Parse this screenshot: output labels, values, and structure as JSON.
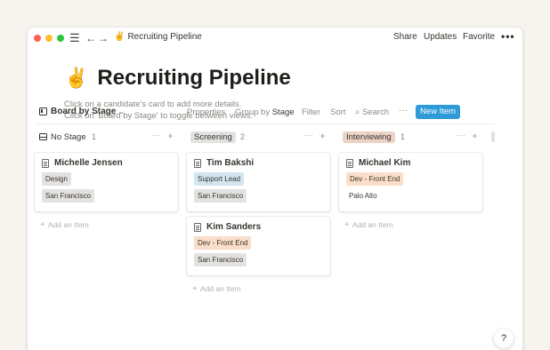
{
  "titlebar": {
    "menu_icon": "hamburger-menu-icon",
    "back_icon": "arrow-left-icon",
    "forward_icon": "arrow-right-icon",
    "emoji": "✌️",
    "title": "Recruiting Pipeline",
    "share": "Share",
    "updates": "Updates",
    "favorite": "Favorite",
    "more": "•••"
  },
  "page": {
    "emoji": "✌️",
    "title": "Recruiting Pipeline",
    "desc_line1": "Click on a candidate's card to add more details.",
    "desc_line2": "Click on 'Board by Stage' to toggle between views."
  },
  "viewbar": {
    "view_name": "Board by Stage",
    "properties": "Properties",
    "group_by_prefix": "Group by",
    "group_by_value": "Stage",
    "filter": "Filter",
    "sort": "Sort",
    "search": "Search",
    "more": "···",
    "new_item": "New Item",
    "accent": "#2e9ad8"
  },
  "columns": [
    {
      "name": "No Stage",
      "count": "1",
      "cards": [
        {
          "title": "Michelle Jensen",
          "role": "Design",
          "location": "San Francisco"
        }
      ],
      "add_item": "Add an Item"
    },
    {
      "name": "Screening",
      "count": "2",
      "cards": [
        {
          "title": "Tim Bakshi",
          "role": "Support Lead",
          "location": "San Francisco"
        },
        {
          "title": "Kim Sanders",
          "role": "Dev - Front End",
          "location": "San Francisco"
        }
      ],
      "add_item": "Add an Item"
    },
    {
      "name": "Interviewing",
      "count": "1",
      "cards": [
        {
          "title": "Michael Kim",
          "role": "Dev - Front End",
          "location": "Palo Alto"
        }
      ],
      "add_item": "Add an Item"
    }
  ],
  "column_actions": {
    "more": "···",
    "add": "+"
  },
  "help": "?"
}
